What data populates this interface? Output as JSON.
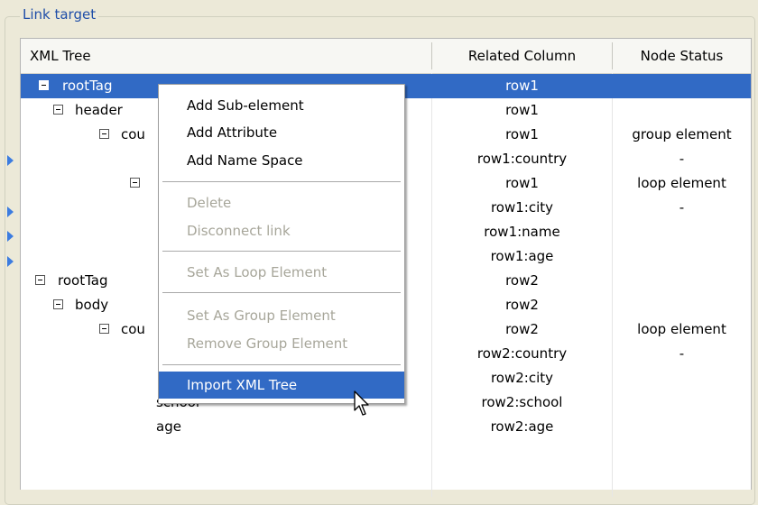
{
  "group_title": "Link target",
  "columns": {
    "xml_tree": "XML Tree",
    "related_column": "Related Column",
    "node_status": "Node Status"
  },
  "rows": [
    {
      "node": "rootTag",
      "related": "row1",
      "status": ""
    },
    {
      "node": "header",
      "related": "row1",
      "status": ""
    },
    {
      "node": "cou",
      "related": "row1",
      "status": "group element"
    },
    {
      "node": "",
      "related": "row1:country",
      "status": "-"
    },
    {
      "node": "",
      "related": "row1",
      "status": "loop element"
    },
    {
      "node": "",
      "related": "row1:city",
      "status": "-"
    },
    {
      "node": "",
      "related": "row1:name",
      "status": ""
    },
    {
      "node": "",
      "related": "row1:age",
      "status": ""
    },
    {
      "node": "rootTag",
      "related": "row2",
      "status": ""
    },
    {
      "node": "body",
      "related": "row2",
      "status": ""
    },
    {
      "node": "cou",
      "related": "row2",
      "status": "loop element"
    },
    {
      "node": "",
      "related": "row2:country",
      "status": "-"
    },
    {
      "node": "",
      "related": "row2:city",
      "status": ""
    },
    {
      "node": "school",
      "related": "row2:school",
      "status": ""
    },
    {
      "node": "age",
      "related": "row2:age",
      "status": ""
    }
  ],
  "context_menu": {
    "add_sub_element": "Add Sub-element",
    "add_attribute": "Add Attribute",
    "add_name_space": "Add Name Space",
    "delete": "Delete",
    "disconnect_link": "Disconnect link",
    "set_as_loop_element": "Set As Loop Element",
    "set_as_group_element": "Set As Group Element",
    "remove_group_element": "Remove Group Element",
    "import_xml_tree": "Import XML Tree"
  },
  "colors": {
    "selection": "#316ac5",
    "legend_text": "#1f4ea8",
    "link_arrow": "#3c7ce0"
  },
  "icons": {
    "expanded": "minus-box-icon",
    "link_arrow": "link-arrow-icon",
    "cursor": "mouse-pointer-icon"
  }
}
